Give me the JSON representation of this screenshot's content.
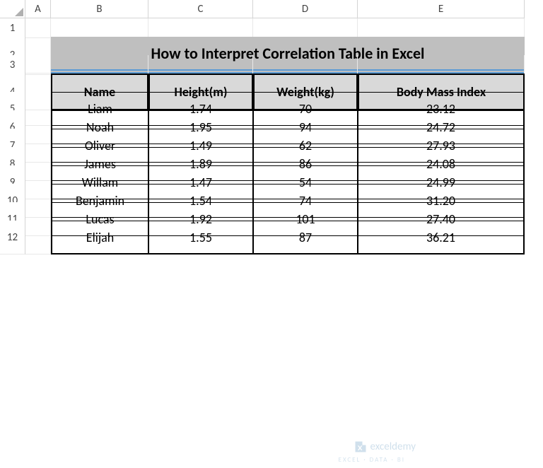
{
  "columns": [
    "A",
    "B",
    "C",
    "D",
    "E"
  ],
  "rows": [
    "1",
    "2",
    "3",
    "4",
    "5",
    "6",
    "7",
    "8",
    "9",
    "10",
    "11",
    "12"
  ],
  "title": "How to Interpret Correlation Table in Excel",
  "headers": {
    "name": "Name",
    "height": "Height(m)",
    "weight": "Weight(kg)",
    "bmi": "Body Mass Index"
  },
  "chart_data": {
    "type": "table",
    "columns": [
      "Name",
      "Height(m)",
      "Weight(kg)",
      "Body Mass Index"
    ],
    "rows": [
      {
        "name": "Liam",
        "height": "1.74",
        "weight": "70",
        "bmi": "23.12"
      },
      {
        "name": "Noah",
        "height": "1.95",
        "weight": "94",
        "bmi": "24.72"
      },
      {
        "name": "Oliver",
        "height": "1.49",
        "weight": "62",
        "bmi": "27.93"
      },
      {
        "name": "James",
        "height": "1.89",
        "weight": "86",
        "bmi": "24.08"
      },
      {
        "name": "Willam",
        "height": "1.47",
        "weight": "54",
        "bmi": "24.99"
      },
      {
        "name": "Benjamin",
        "height": "1.54",
        "weight": "74",
        "bmi": "31.20"
      },
      {
        "name": "Lucas",
        "height": "1.92",
        "weight": "101",
        "bmi": "27.40"
      },
      {
        "name": "Elijah",
        "height": "1.55",
        "weight": "87",
        "bmi": "36.21"
      }
    ]
  },
  "watermark": {
    "text": "exceldemy",
    "sub": "EXCEL · DATA · BI"
  }
}
